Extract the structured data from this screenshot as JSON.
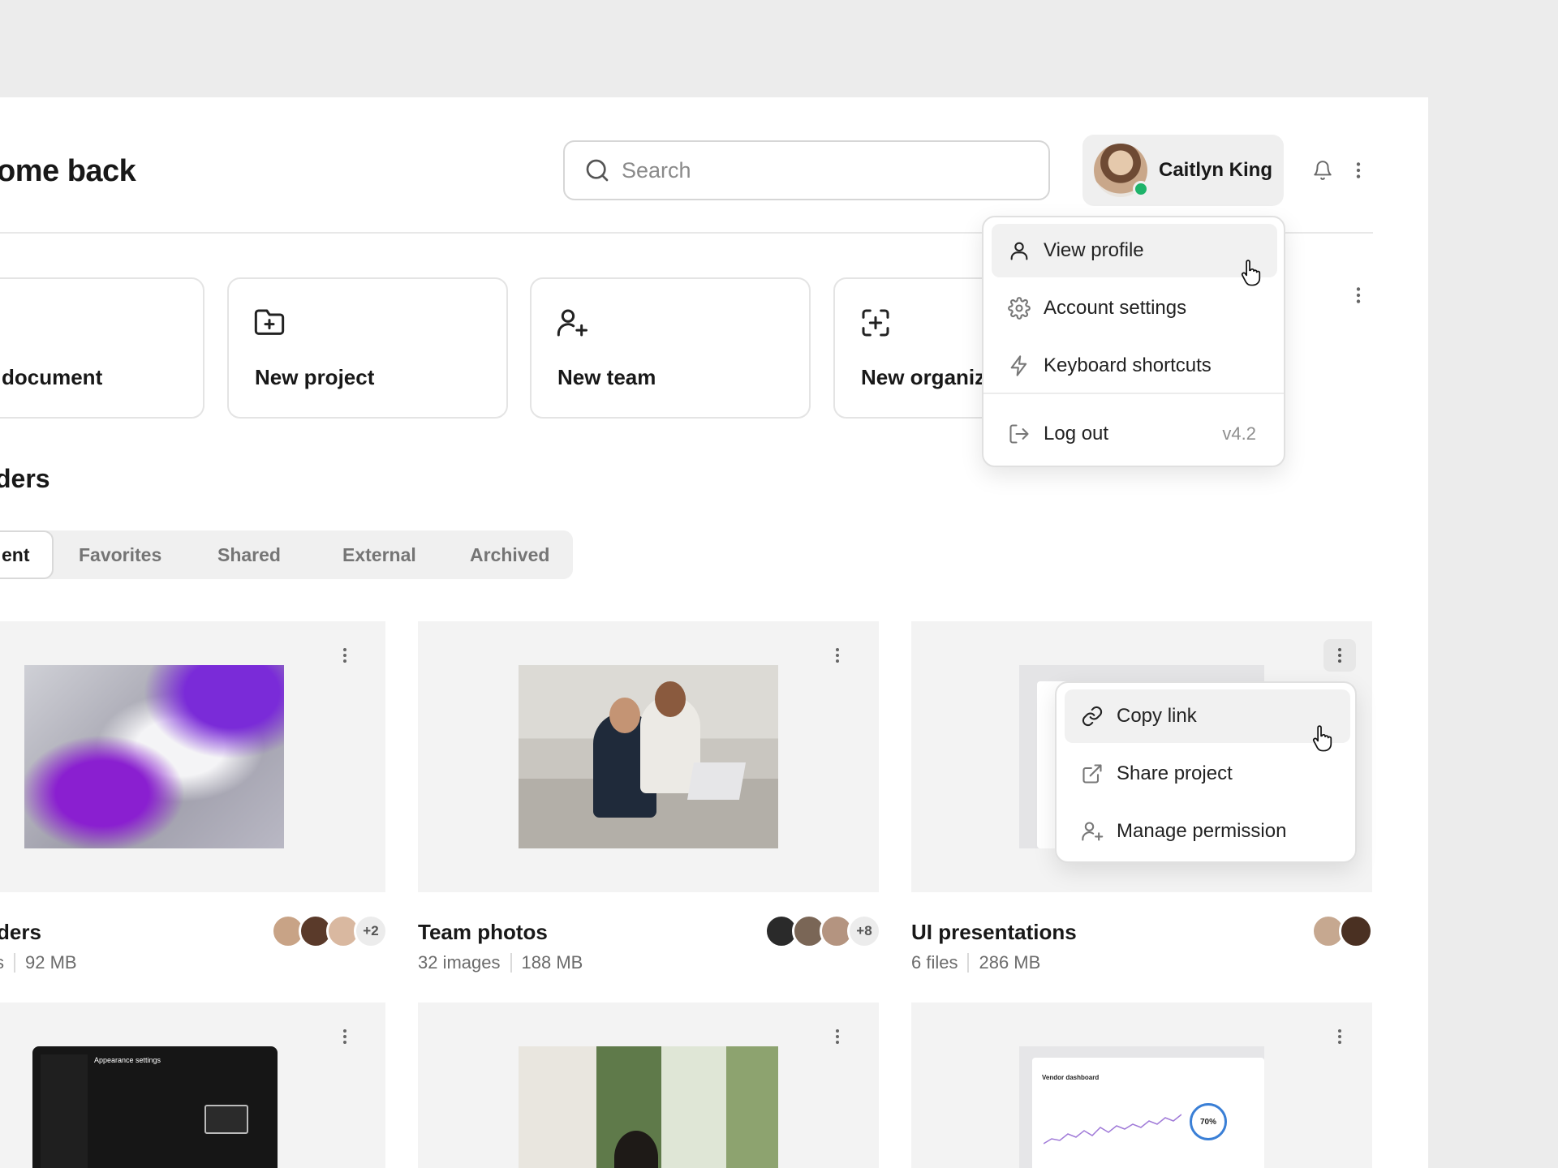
{
  "header": {
    "welcome": "ome back",
    "search_placeholder": "Search",
    "user_name": "Caitlyn King",
    "user_online": true
  },
  "quick_actions": [
    {
      "label": "document",
      "icon": "file-icon"
    },
    {
      "label": "New project",
      "icon": "folder-plus-icon"
    },
    {
      "label": "New team",
      "icon": "user-plus-icon"
    },
    {
      "label": "New organiz",
      "icon": "scan-plus-icon"
    }
  ],
  "profile_menu": {
    "items": [
      {
        "label": "View profile",
        "icon": "user-icon",
        "active": true
      },
      {
        "label": "Account settings",
        "icon": "gear-icon"
      },
      {
        "label": "Keyboard shortcuts",
        "icon": "lightning-icon"
      },
      {
        "label": "Log out",
        "icon": "logout-icon"
      }
    ],
    "version": "v4.2"
  },
  "folders_section": {
    "title": "ders",
    "tabs": [
      {
        "label": "ent",
        "active": true
      },
      {
        "label": "Favorites"
      },
      {
        "label": "Shared"
      },
      {
        "label": "External"
      },
      {
        "label": "Archived"
      }
    ]
  },
  "folders": [
    {
      "title": "ders",
      "count": "s",
      "size": "92 MB",
      "more": "+2"
    },
    {
      "title": "Team photos",
      "count": "32 images",
      "size": "188 MB",
      "more": "+8"
    },
    {
      "title": "UI presentations",
      "count": "6 files",
      "size": "286 MB",
      "more": ""
    }
  ],
  "context_menu": {
    "items": [
      {
        "label": "Copy link",
        "icon": "link-icon",
        "active": true
      },
      {
        "label": "Share project",
        "icon": "external-link-icon"
      },
      {
        "label": "Manage permission",
        "icon": "user-plus-icon"
      }
    ]
  },
  "thumb_texts": {
    "settings_title": "Appearance settings",
    "dashboard_title": "Vendor dashboard",
    "dashboard_percent": "70%"
  },
  "colors": {
    "accent_status": "#1eb36a",
    "page_bg": "#ececec",
    "tile_bg": "#f3f3f3"
  }
}
